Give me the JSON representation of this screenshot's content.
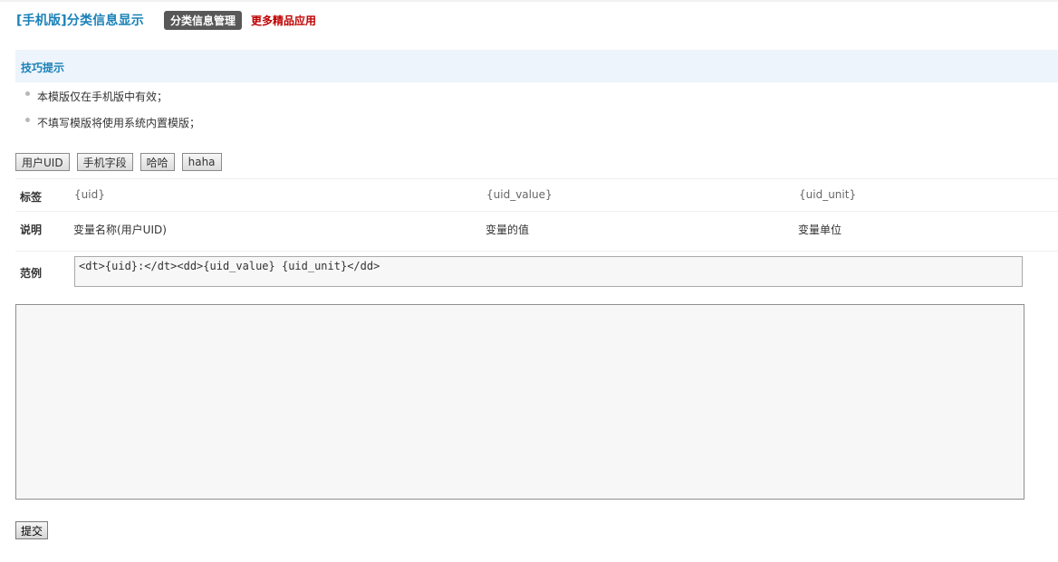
{
  "header": {
    "title": "[手机版]分类信息显示",
    "manage_label": "分类信息管理",
    "more_label": "更多精品应用"
  },
  "tips": {
    "title": "技巧提示",
    "items": [
      "本模版仅在手机版中有效；",
      "不填写模版将使用系统内置模版；"
    ]
  },
  "variables": [
    "用户UID",
    "手机字段",
    "哈哈",
    "haha"
  ],
  "table": {
    "tag_label": "标签",
    "tags": [
      "{uid}",
      "{uid_value}",
      "{uid_unit}"
    ],
    "desc_label": "说明",
    "descs": [
      "变量名称(用户UID)",
      "变量的值",
      "变量单位"
    ],
    "example_label": "范例",
    "example": "<dt>{uid}:</dt><dd>{uid_value} {uid_unit}</dd>"
  },
  "editor": {
    "value": ""
  },
  "submit_label": "提交",
  "colors": {
    "title": "#1a81b8",
    "more": "#c00000",
    "tips_bg": "#eef4fb",
    "pill": "#585858"
  }
}
